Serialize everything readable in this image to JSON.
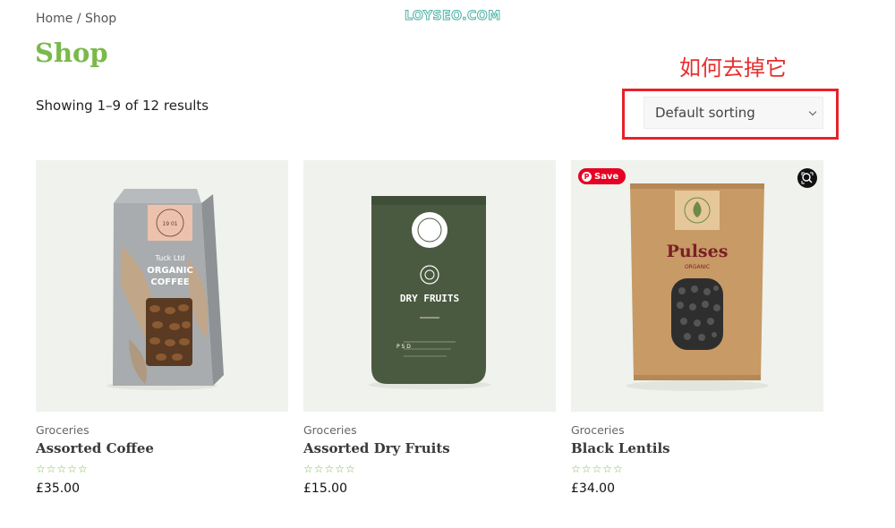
{
  "breadcrumb": {
    "home": "Home",
    "separator": " / ",
    "current": "Shop"
  },
  "watermark": "LOYSEO.COM",
  "page_title": "Shop",
  "annotation": "如何去掉它",
  "result_count": "Showing 1–9 of 12 results",
  "sorting": {
    "selected": "Default sorting",
    "icon": "chevron-down-icon"
  },
  "colors": {
    "accent_green": "#7ab94a",
    "highlight_red": "#e8222a",
    "pinterest_red": "#e60023"
  },
  "products": [
    {
      "category": "Groceries",
      "name": "Assorted Coffee",
      "price": "£35.00",
      "rating_stars": "☆☆☆☆☆",
      "package": {
        "line1": "Tuck Ltd",
        "line2": "ORGANIC",
        "line3": "COFFEE",
        "badge": "19 01"
      }
    },
    {
      "category": "Groceries",
      "name": "Assorted Dry Fruits",
      "price": "£15.00",
      "rating_stars": "☆☆☆☆☆",
      "package": {
        "title": "DRY FRUITS",
        "side": "P S D"
      }
    },
    {
      "category": "Groceries",
      "name": "Black Lentils",
      "price": "£34.00",
      "rating_stars": "☆☆☆☆☆",
      "package": {
        "title": "Pulses",
        "subtitle": "ORGANIC"
      },
      "save_label": "Save"
    }
  ]
}
